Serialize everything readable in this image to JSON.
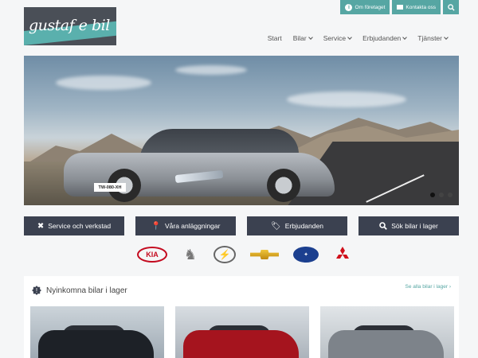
{
  "header": {
    "logo_text": "gustaf e bil",
    "util": {
      "about_label": "Om företaget",
      "contact_label": "Kontakta oss"
    },
    "nav": [
      {
        "label": "Start"
      },
      {
        "label": "Bilar"
      },
      {
        "label": "Service"
      },
      {
        "label": "Erbjudanden"
      },
      {
        "label": "Tjänster"
      }
    ]
  },
  "hero": {
    "plate_text": "TW-080-XH",
    "slides_total": 3,
    "active_slide": 1
  },
  "actions": [
    {
      "label": "Service och verkstad",
      "icon": "tools-icon"
    },
    {
      "label": "Våra anläggningar",
      "icon": "map-pin-icon"
    },
    {
      "label": "Erbjudanden",
      "icon": "tag-icon"
    },
    {
      "label": "Sök bilar i lager",
      "icon": "search-icon"
    }
  ],
  "brands": {
    "kia": "KIA",
    "subaru": "SUBARU",
    "icons": [
      "kia-logo",
      "peugeot-logo",
      "opel-logo",
      "chevrolet-logo",
      "subaru-logo",
      "mitsubishi-logo"
    ]
  },
  "new_arrivals": {
    "title": "Nyinkomna bilar i lager",
    "see_all": "Se alla bilar i lager"
  },
  "colors": {
    "accent": "#56a6a3",
    "button_dark": "#3b4150",
    "kia_red": "#c40a1f",
    "mitsubishi_red": "#d0101b"
  }
}
